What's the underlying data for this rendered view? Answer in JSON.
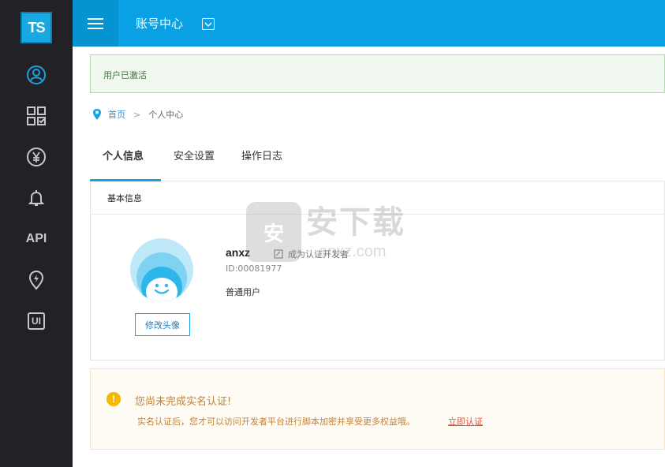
{
  "app": {
    "logo_text": "TS"
  },
  "sidebar": {
    "items": [
      {
        "icon": "user-circle-icon"
      },
      {
        "icon": "apps-grid-icon"
      },
      {
        "icon": "yen-circle-icon"
      },
      {
        "icon": "bell-icon"
      },
      {
        "icon": "api-text-icon",
        "label": "API"
      },
      {
        "icon": "location-bolt-icon"
      },
      {
        "icon": "ui-box-icon",
        "label": "UI"
      }
    ]
  },
  "header": {
    "title": "账号中心"
  },
  "alert": {
    "text": "用户已激活"
  },
  "breadcrumb": {
    "home": "首页",
    "separator": ">",
    "current": "个人中心"
  },
  "tabs": [
    {
      "label": "个人信息",
      "active": true
    },
    {
      "label": "安全设置",
      "active": false
    },
    {
      "label": "操作日志",
      "active": false
    }
  ],
  "profile": {
    "section_title": "基本信息",
    "username": "anxz",
    "verify_label": "成为认证开发者",
    "id": "ID:00081977",
    "role": "普通用户",
    "change_avatar_label": "修改头像"
  },
  "notice": {
    "title": "您尚未完成实名认证!",
    "body": "实名认证后，您才可以访问开发者平台进行脚本加密并享受更多权益哦。",
    "link": "立即认证",
    "icon_glyph": "!"
  },
  "watermark": {
    "title": "安下载",
    "subtitle": "anxz.com",
    "glyph": "安"
  },
  "colors": {
    "accent": "#0aa1e4",
    "sidebar": "#222226",
    "notice_text": "#c0843a",
    "link_red": "#e0553a"
  }
}
